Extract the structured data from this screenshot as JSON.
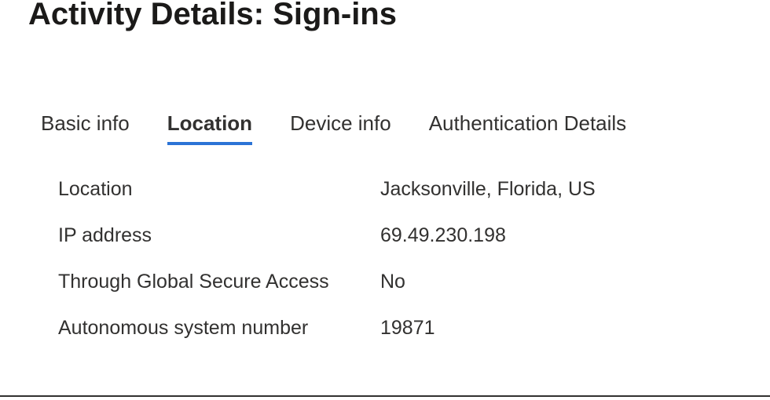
{
  "header": {
    "title": "Activity Details: Sign-ins"
  },
  "tabs": {
    "items": [
      {
        "label": "Basic info",
        "active": false
      },
      {
        "label": "Location",
        "active": true
      },
      {
        "label": "Device info",
        "active": false
      },
      {
        "label": "Authentication Details",
        "active": false
      }
    ]
  },
  "details": {
    "rows": [
      {
        "label": "Location",
        "value": "Jacksonville, Florida, US"
      },
      {
        "label": "IP address",
        "value": "69.49.230.198"
      },
      {
        "label": "Through Global Secure Access",
        "value": "No"
      },
      {
        "label": "Autonomous system number",
        "value": "19871"
      }
    ]
  }
}
